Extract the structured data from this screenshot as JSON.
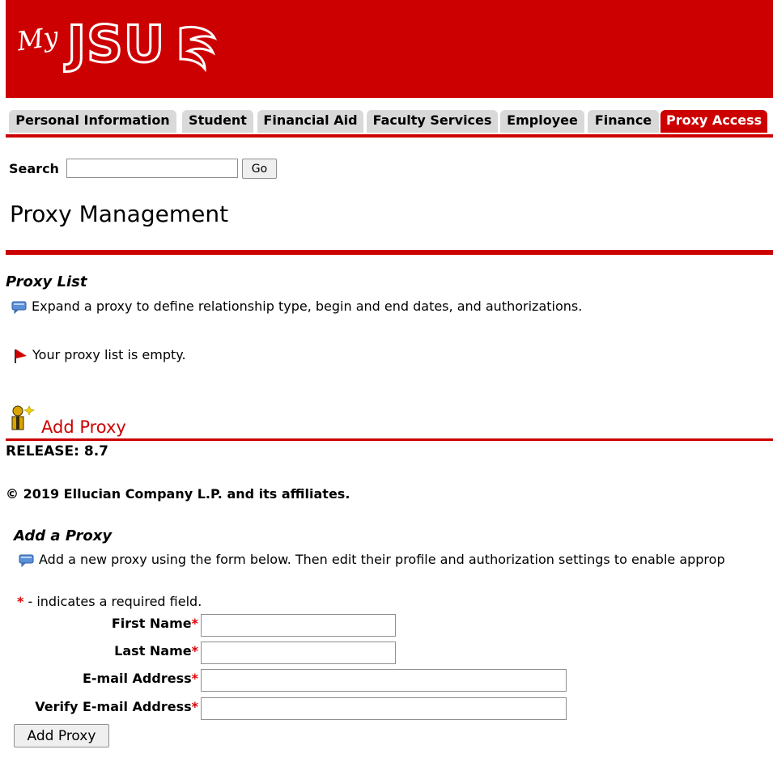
{
  "brand": {
    "logo_my": "My",
    "logo_main": "JSU",
    "color": "#cc0000"
  },
  "tabs": [
    {
      "label": "Personal Information",
      "active": false
    },
    {
      "label": "Student",
      "active": false
    },
    {
      "label": "Financial Aid",
      "active": false
    },
    {
      "label": "Faculty Services",
      "active": false
    },
    {
      "label": "Employee",
      "active": false
    },
    {
      "label": "Finance",
      "active": false
    },
    {
      "label": "Proxy Access",
      "active": true
    }
  ],
  "search": {
    "label": "Search",
    "value": "",
    "button": "Go"
  },
  "page_title": "Proxy Management",
  "proxy_list": {
    "title": "Proxy List",
    "info": "Expand a proxy to define relationship type, begin and end dates, and authorizations.",
    "empty_message": "Your proxy list is empty."
  },
  "add_proxy_link": "Add Proxy",
  "footer": {
    "release": "RELEASE: 8.7",
    "copyright": "© 2019 Ellucian Company L.P. and its affiliates."
  },
  "add_form": {
    "title": "Add a Proxy",
    "info": "Add a new proxy using the form below. Then edit their profile and authorization settings to enable approp",
    "required_note": "- indicates a required field.",
    "required_marker": "*",
    "fields": {
      "first_name": {
        "label": "First Name",
        "value": ""
      },
      "last_name": {
        "label": "Last Name",
        "value": ""
      },
      "email": {
        "label": "E-mail Address",
        "value": ""
      },
      "verify_email": {
        "label": "Verify E-mail Address",
        "value": ""
      }
    },
    "submit": "Add Proxy"
  }
}
